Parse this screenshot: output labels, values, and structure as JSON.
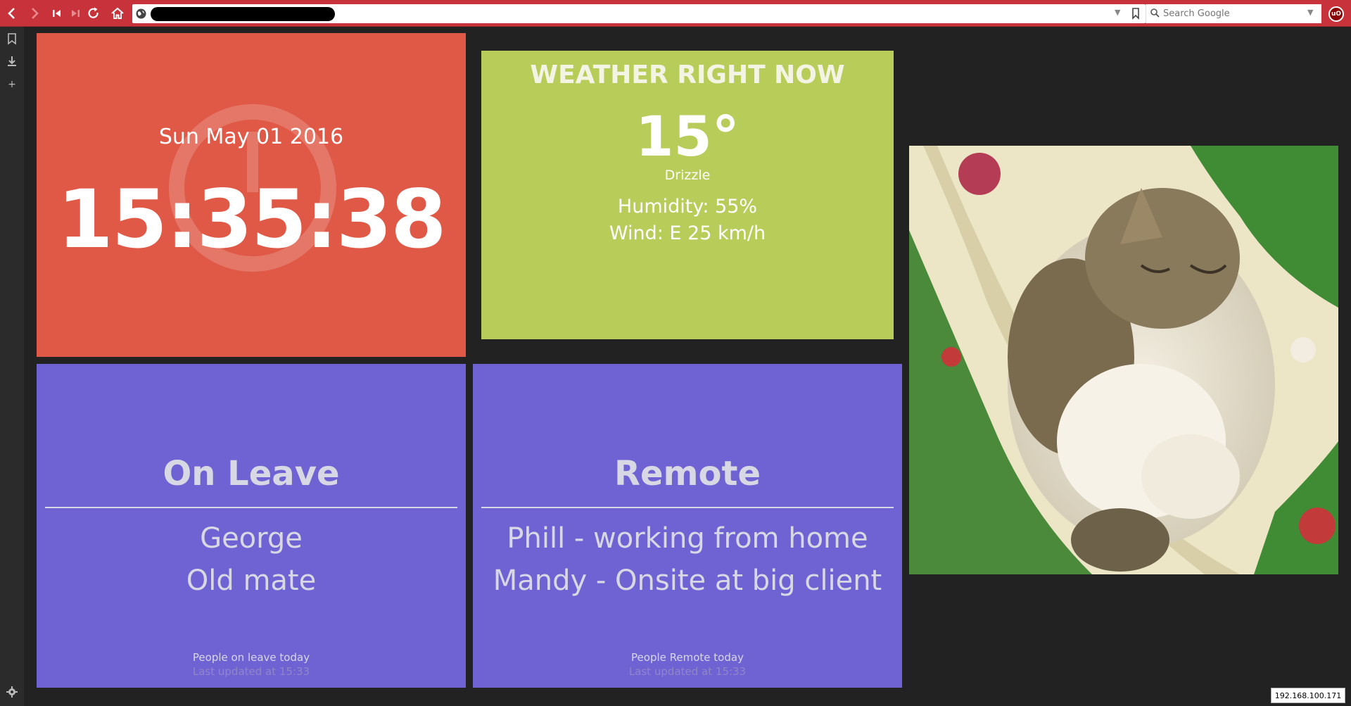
{
  "browser": {
    "search_placeholder": "Search Google",
    "extension_label": "uO"
  },
  "clock": {
    "date": "Sun May 01 2016",
    "time": "15:35:38"
  },
  "weather": {
    "title": "WEATHER RIGHT NOW",
    "temperature": "15°",
    "condition": "Drizzle",
    "humidity": "Humidity: 55%",
    "wind": "Wind: E 25 km/h"
  },
  "on_leave": {
    "title": "On Leave",
    "people": [
      "George",
      "Old mate"
    ],
    "subtitle": "People on leave today",
    "updated": "Last updated at 15:33"
  },
  "remote": {
    "title": "Remote",
    "people": [
      "Phill - working from home",
      "Mandy - Onsite at big client"
    ],
    "subtitle": "People Remote today",
    "updated": "Last updated at 15:33"
  },
  "status": {
    "ip": "192.168.100.171"
  },
  "colors": {
    "toolbar": "#c8323a",
    "clock_tile": "#e05947",
    "weather_tile": "#b8cc5a",
    "panel_tile": "#6f63d4",
    "background": "#222222"
  }
}
